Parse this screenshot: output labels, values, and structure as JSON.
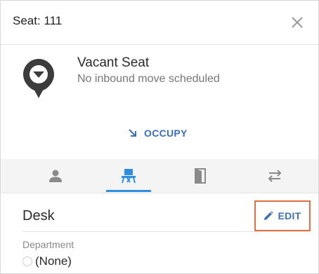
{
  "header": {
    "title": "Seat: 111",
    "close_icon": "close-icon"
  },
  "status": {
    "icon": "location-pin-icon",
    "title": "Vacant Seat",
    "subtitle": "No inbound move scheduled"
  },
  "actions": {
    "occupy_label": "OCCUPY",
    "occupy_icon": "arrow-down-right-icon"
  },
  "tabs": {
    "items": [
      {
        "icon": "person-icon",
        "selected": false
      },
      {
        "icon": "desk-chair-icon",
        "selected": true
      },
      {
        "icon": "door-icon",
        "selected": false
      },
      {
        "icon": "swap-arrows-icon",
        "selected": false
      }
    ],
    "accent_color": "#2f8ee0"
  },
  "section": {
    "title": "Desk",
    "edit_label": "EDIT",
    "edit_icon": "pencil-icon"
  },
  "fields": [
    {
      "label": "Department",
      "value": "(None)"
    }
  ],
  "colors": {
    "link": "#3b6fb6",
    "highlight_border": "#e0703f",
    "pin_dark": "#3c3c3c"
  }
}
